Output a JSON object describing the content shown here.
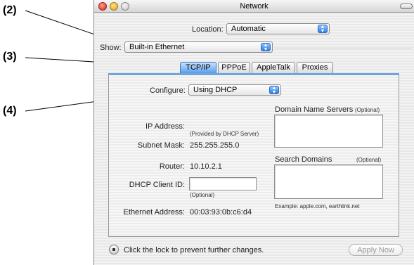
{
  "callouts": {
    "c2": "(2)",
    "c3": "(3)",
    "c4": "(4)"
  },
  "window": {
    "title": "Network"
  },
  "location": {
    "label": "Location:",
    "value": "Automatic"
  },
  "show": {
    "label": "Show:",
    "value": "Built-in Ethernet"
  },
  "tabs": [
    {
      "label": "TCP/IP"
    },
    {
      "label": "PPPoE"
    },
    {
      "label": "AppleTalk"
    },
    {
      "label": "Proxies"
    }
  ],
  "configure": {
    "label": "Configure:",
    "value": "Using DHCP"
  },
  "ip_address": {
    "label": "IP Address:",
    "note": "(Provided by DHCP Server)"
  },
  "subnet_mask": {
    "label": "Subnet Mask:",
    "value": "255.255.255.0"
  },
  "router": {
    "label": "Router:",
    "value": "10.10.2.1"
  },
  "dhcp_client_id": {
    "label": "DHCP Client ID:",
    "value": "",
    "note": "(Optional)"
  },
  "ethernet_address": {
    "label": "Ethernet Address:",
    "value": "00:03:93:0b:c6:d4"
  },
  "dns": {
    "label": "Domain Name Servers",
    "optional": "(Optional)"
  },
  "search_domains": {
    "label": "Search Domains",
    "optional": "(Optional)",
    "example": "Example: apple.com, earthlink.net"
  },
  "footer": {
    "lock_text": "Click the lock to prevent further changes.",
    "apply_label": "Apply Now"
  },
  "colors": {
    "accent": "#5a9ee8",
    "close": "#d8281d",
    "minimize": "#e0a31a"
  },
  "icons": {
    "lock": "lock-icon",
    "popup_arrow": "updown-arrows-icon"
  }
}
